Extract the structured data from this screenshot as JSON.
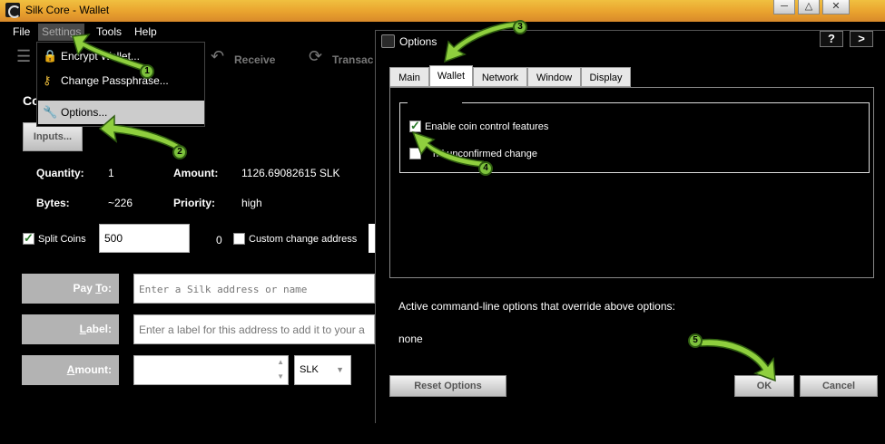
{
  "window": {
    "title": "Silk Core - Wallet"
  },
  "menubar": {
    "items": [
      "File",
      "Settings",
      "Tools",
      "Help"
    ]
  },
  "toolbar": {
    "receive": "Receive",
    "transactions": "Transac"
  },
  "settings_menu": {
    "items": [
      {
        "label": "Encrypt Wallet...",
        "icon": "lock-icon"
      },
      {
        "label": "Change Passphrase...",
        "icon": "key-icon"
      },
      {
        "label": "Options...",
        "icon": "wrench-icon"
      }
    ]
  },
  "coin_control": {
    "heading": "Co",
    "inputs_button": "Inputs...",
    "quantity_label": "Quantity:",
    "quantity_value": "1",
    "amount_label": "Amount:",
    "amount_value": "1126.69082615 SLK",
    "bytes_label": "Bytes:",
    "bytes_value": "~226",
    "priority_label": "Priority:",
    "priority_value": "high",
    "split_coins_label": "Split Coins",
    "split_coins_checked": true,
    "split_value": "500",
    "split_count": "0",
    "custom_change_label": "Custom change address",
    "custom_change_checked": false
  },
  "send_form": {
    "pay_to_label_pre": "Pay ",
    "pay_to_label_u": "T",
    "pay_to_label_post": "o:",
    "pay_to_placeholder": "Enter a Silk address or name",
    "label_label_u": "L",
    "label_label_post": "abel:",
    "label_placeholder": "Enter a label for this address to add it to your a",
    "amount_label_u": "A",
    "amount_label_post": "mount:",
    "unit": "SLK"
  },
  "options_dialog": {
    "title": "Options",
    "help_button": "?",
    "next_button": ">",
    "tabs": [
      "Main",
      "Wallet",
      "Network",
      "Window",
      "Display"
    ],
    "active_tab": "Wallet",
    "enable_coin_control_label": "Enable coin control features",
    "enable_coin_control_checked": true,
    "spend_unconfirmed_label": "nd unconfirmed change",
    "override_label": "Active command-line options that override above options:",
    "override_value": "none",
    "reset_button": "Reset Options",
    "ok_button": "OK",
    "cancel_button": "Cancel"
  },
  "annotations": {
    "steps": [
      "1",
      "2",
      "3",
      "4",
      "5"
    ],
    "color": "#7dc23c"
  },
  "colors": {
    "titlebar": "#e9a22e",
    "label_box": "#b3b3b3",
    "menu_highlight": "#cccccc"
  }
}
